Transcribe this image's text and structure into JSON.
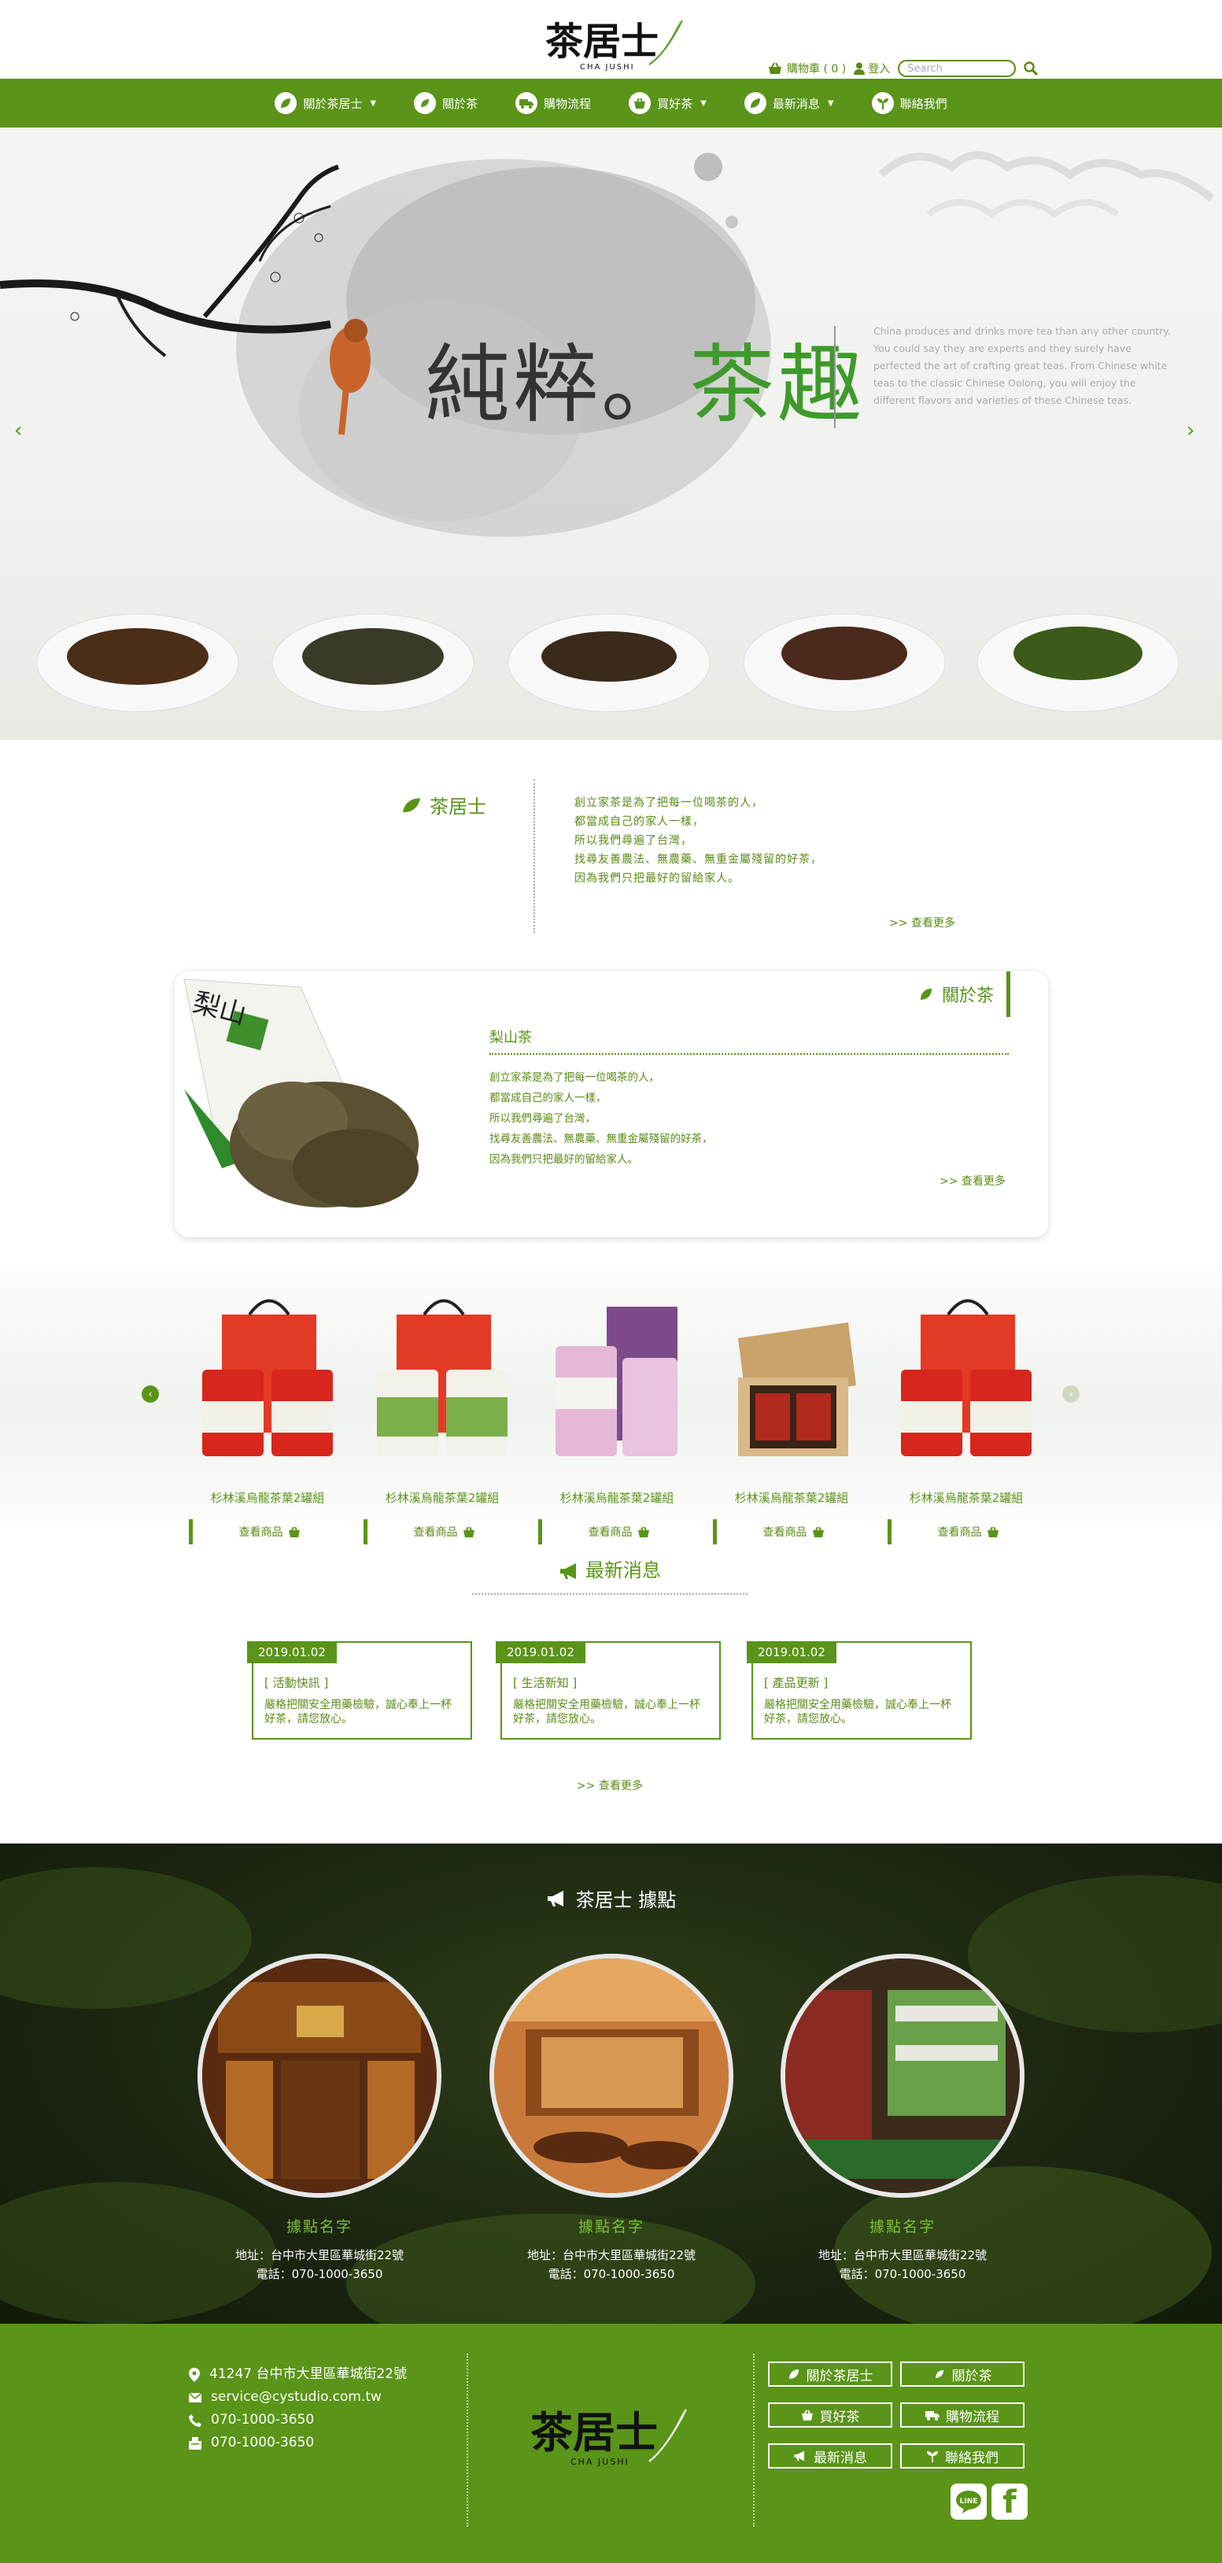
{
  "header": {
    "cart_label": "購物車 ( 0 )",
    "login_label": "登入",
    "search_placeholder": "Search"
  },
  "nav": {
    "items": [
      {
        "label": "關於茶居士",
        "icon": "leaf-icon",
        "has_dropdown": true
      },
      {
        "label": "關於茶",
        "icon": "leaf-icon",
        "has_dropdown": false
      },
      {
        "label": "購物流程",
        "icon": "truck-icon",
        "has_dropdown": false
      },
      {
        "label": "買好茶",
        "icon": "basket-icon",
        "has_dropdown": true
      },
      {
        "label": "最新消息",
        "icon": "leaf-icon",
        "has_dropdown": true
      },
      {
        "label": "聯絡我們",
        "icon": "sprout-icon",
        "has_dropdown": false
      }
    ]
  },
  "hero": {
    "slogan_a": "純粹",
    "slogan_dot": "。",
    "slogan_b": "茶趣",
    "description": "China produces and drinks more tea than any other country. You could say they are experts and they surely have perfected the art of crafting great teas. From Chinese white teas to the classic Chinese Oolong, you will enjoy the different flavors and varieties of these Chinese teas."
  },
  "about": {
    "title": "茶居士",
    "lines": [
      "創立家茶是為了把每一位喝茶的人，",
      "都當成自己的家人一樣，",
      "所以我們尋遍了台灣，",
      "找尋友善農法、無農藥、無重金屬殘留的好茶，",
      "因為我們只把最好的留給家人。"
    ],
    "more": ">> 查看更多"
  },
  "tea_card": {
    "tab": "關於茶",
    "name": "梨山茶",
    "lines": [
      "創立家茶是為了把每一位喝茶的人，",
      "都當成自己的家人一樣，",
      "所以我們尋遍了台灣，",
      "找尋友善農法、無農藥、無重金屬殘留的好茶，",
      "因為我們只把最好的留給家人。"
    ],
    "more": ">> 查看更多"
  },
  "products": {
    "items": [
      {
        "name": "杉林溪烏龍茶葉2罐組",
        "button": "查看商品"
      },
      {
        "name": "杉林溪烏龍茶葉2罐組",
        "button": "查看商品"
      },
      {
        "name": "杉林溪烏龍茶葉2罐組",
        "button": "查看商品"
      },
      {
        "name": "杉林溪烏龍茶葉2罐組",
        "button": "查看商品"
      },
      {
        "name": "杉林溪烏龍茶葉2罐組",
        "button": "查看商品"
      }
    ]
  },
  "news": {
    "title": "最新消息",
    "items": [
      {
        "date": "2019.01.02",
        "category": "[ 活動快訊 ]",
        "body": "嚴格把關安全用藥檢驗，誠心奉上一杯好茶，請您放心。"
      },
      {
        "date": "2019.01.02",
        "category": "[ 生活新知 ]",
        "body": "嚴格把關安全用藥檢驗，誠心奉上一杯好茶，請您放心。"
      },
      {
        "date": "2019.01.02",
        "category": "[ 產品更新 ]",
        "body": "嚴格把關安全用藥檢驗，誠心奉上一杯好茶，請您放心。"
      }
    ],
    "more": ">> 查看更多"
  },
  "locations": {
    "title": "茶居士 據點",
    "items": [
      {
        "name": "據點名字",
        "address": "地址：台中市大里區華城街22號",
        "phone": "電話：070-1000-3650"
      },
      {
        "name": "據點名字",
        "address": "地址：台中市大里區華城街22號",
        "phone": "電話：070-1000-3650"
      },
      {
        "name": "據點名字",
        "address": "地址：台中市大里區華城街22號",
        "phone": "電話：070-1000-3650"
      }
    ]
  },
  "footer": {
    "address": "41247 台中市大里區華城街22號",
    "email": "service@cystudio.com.tw",
    "phone": "070-1000-3650",
    "fax": "070-1000-3650",
    "links": [
      {
        "label": "關於茶居士",
        "icon": "leaf-icon"
      },
      {
        "label": "關於茶",
        "icon": "leaf-icon"
      },
      {
        "label": "買好茶",
        "icon": "basket-icon"
      },
      {
        "label": "購物流程",
        "icon": "truck-icon"
      },
      {
        "label": "最新消息",
        "icon": "megaphone-icon"
      },
      {
        "label": "聯絡我們",
        "icon": "sprout-icon"
      }
    ],
    "social": [
      {
        "name": "LINE",
        "icon": "line-icon"
      },
      {
        "name": "f",
        "icon": "facebook-icon"
      }
    ]
  },
  "brand": {
    "logo_text": "茶居士",
    "logo_sub": "CHA JUSHI",
    "green": "#5a9418",
    "dark_green": "#3f9a2c"
  }
}
